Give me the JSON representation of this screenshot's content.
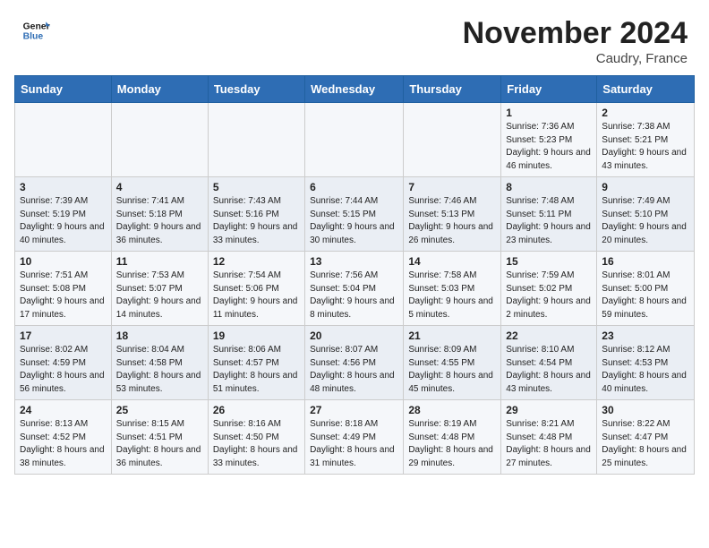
{
  "header": {
    "logo_line1": "General",
    "logo_line2": "Blue",
    "month": "November 2024",
    "location": "Caudry, France"
  },
  "weekdays": [
    "Sunday",
    "Monday",
    "Tuesday",
    "Wednesday",
    "Thursday",
    "Friday",
    "Saturday"
  ],
  "weeks": [
    [
      {
        "day": "",
        "info": ""
      },
      {
        "day": "",
        "info": ""
      },
      {
        "day": "",
        "info": ""
      },
      {
        "day": "",
        "info": ""
      },
      {
        "day": "",
        "info": ""
      },
      {
        "day": "1",
        "info": "Sunrise: 7:36 AM\nSunset: 5:23 PM\nDaylight: 9 hours and 46 minutes."
      },
      {
        "day": "2",
        "info": "Sunrise: 7:38 AM\nSunset: 5:21 PM\nDaylight: 9 hours and 43 minutes."
      }
    ],
    [
      {
        "day": "3",
        "info": "Sunrise: 7:39 AM\nSunset: 5:19 PM\nDaylight: 9 hours and 40 minutes."
      },
      {
        "day": "4",
        "info": "Sunrise: 7:41 AM\nSunset: 5:18 PM\nDaylight: 9 hours and 36 minutes."
      },
      {
        "day": "5",
        "info": "Sunrise: 7:43 AM\nSunset: 5:16 PM\nDaylight: 9 hours and 33 minutes."
      },
      {
        "day": "6",
        "info": "Sunrise: 7:44 AM\nSunset: 5:15 PM\nDaylight: 9 hours and 30 minutes."
      },
      {
        "day": "7",
        "info": "Sunrise: 7:46 AM\nSunset: 5:13 PM\nDaylight: 9 hours and 26 minutes."
      },
      {
        "day": "8",
        "info": "Sunrise: 7:48 AM\nSunset: 5:11 PM\nDaylight: 9 hours and 23 minutes."
      },
      {
        "day": "9",
        "info": "Sunrise: 7:49 AM\nSunset: 5:10 PM\nDaylight: 9 hours and 20 minutes."
      }
    ],
    [
      {
        "day": "10",
        "info": "Sunrise: 7:51 AM\nSunset: 5:08 PM\nDaylight: 9 hours and 17 minutes."
      },
      {
        "day": "11",
        "info": "Sunrise: 7:53 AM\nSunset: 5:07 PM\nDaylight: 9 hours and 14 minutes."
      },
      {
        "day": "12",
        "info": "Sunrise: 7:54 AM\nSunset: 5:06 PM\nDaylight: 9 hours and 11 minutes."
      },
      {
        "day": "13",
        "info": "Sunrise: 7:56 AM\nSunset: 5:04 PM\nDaylight: 9 hours and 8 minutes."
      },
      {
        "day": "14",
        "info": "Sunrise: 7:58 AM\nSunset: 5:03 PM\nDaylight: 9 hours and 5 minutes."
      },
      {
        "day": "15",
        "info": "Sunrise: 7:59 AM\nSunset: 5:02 PM\nDaylight: 9 hours and 2 minutes."
      },
      {
        "day": "16",
        "info": "Sunrise: 8:01 AM\nSunset: 5:00 PM\nDaylight: 8 hours and 59 minutes."
      }
    ],
    [
      {
        "day": "17",
        "info": "Sunrise: 8:02 AM\nSunset: 4:59 PM\nDaylight: 8 hours and 56 minutes."
      },
      {
        "day": "18",
        "info": "Sunrise: 8:04 AM\nSunset: 4:58 PM\nDaylight: 8 hours and 53 minutes."
      },
      {
        "day": "19",
        "info": "Sunrise: 8:06 AM\nSunset: 4:57 PM\nDaylight: 8 hours and 51 minutes."
      },
      {
        "day": "20",
        "info": "Sunrise: 8:07 AM\nSunset: 4:56 PM\nDaylight: 8 hours and 48 minutes."
      },
      {
        "day": "21",
        "info": "Sunrise: 8:09 AM\nSunset: 4:55 PM\nDaylight: 8 hours and 45 minutes."
      },
      {
        "day": "22",
        "info": "Sunrise: 8:10 AM\nSunset: 4:54 PM\nDaylight: 8 hours and 43 minutes."
      },
      {
        "day": "23",
        "info": "Sunrise: 8:12 AM\nSunset: 4:53 PM\nDaylight: 8 hours and 40 minutes."
      }
    ],
    [
      {
        "day": "24",
        "info": "Sunrise: 8:13 AM\nSunset: 4:52 PM\nDaylight: 8 hours and 38 minutes."
      },
      {
        "day": "25",
        "info": "Sunrise: 8:15 AM\nSunset: 4:51 PM\nDaylight: 8 hours and 36 minutes."
      },
      {
        "day": "26",
        "info": "Sunrise: 8:16 AM\nSunset: 4:50 PM\nDaylight: 8 hours and 33 minutes."
      },
      {
        "day": "27",
        "info": "Sunrise: 8:18 AM\nSunset: 4:49 PM\nDaylight: 8 hours and 31 minutes."
      },
      {
        "day": "28",
        "info": "Sunrise: 8:19 AM\nSunset: 4:48 PM\nDaylight: 8 hours and 29 minutes."
      },
      {
        "day": "29",
        "info": "Sunrise: 8:21 AM\nSunset: 4:48 PM\nDaylight: 8 hours and 27 minutes."
      },
      {
        "day": "30",
        "info": "Sunrise: 8:22 AM\nSunset: 4:47 PM\nDaylight: 8 hours and 25 minutes."
      }
    ]
  ]
}
